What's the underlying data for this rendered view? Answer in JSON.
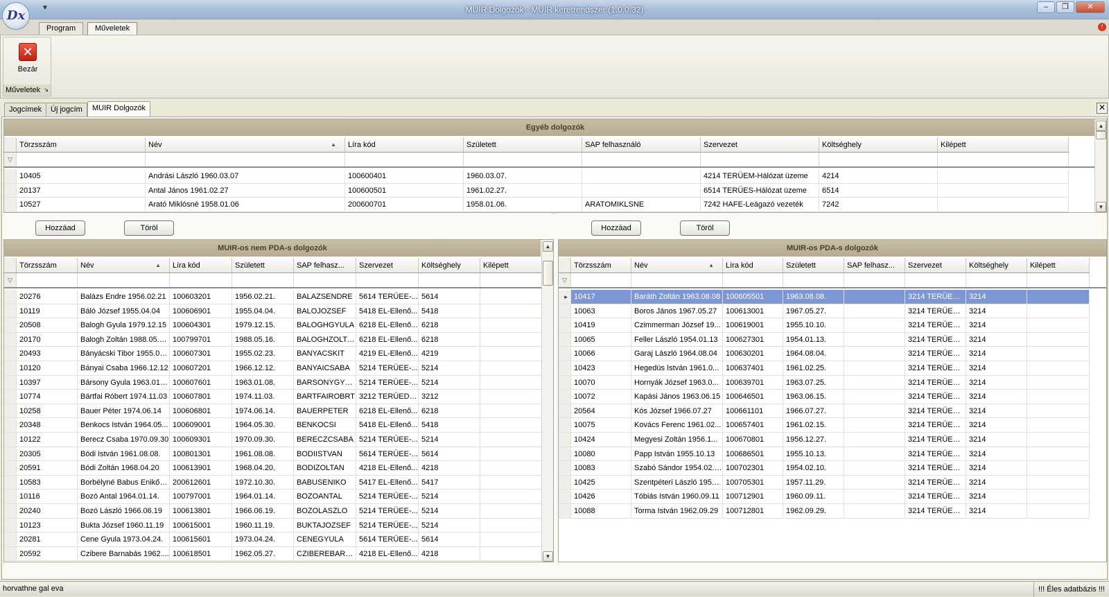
{
  "window": {
    "title": "MUIR Dolgozók - MUIR keretrendszer (1.0.0.32)",
    "logo_text": "Dx"
  },
  "ribbon": {
    "tabs": [
      "Program",
      "Műveletek"
    ],
    "active_tab": "Műveletek",
    "group_label": "Műveletek",
    "close_button": "Bezár"
  },
  "doc_tabs": [
    "Jogcímek",
    "Új jogcím",
    "MUIR Dolgozók"
  ],
  "active_doc_tab": "MUIR Dolgozók",
  "top_panel": {
    "title": "Egyéb dolgozók",
    "columns": [
      "Törzsszám",
      "Név",
      "Líra kód",
      "Született",
      "SAP felhasználó",
      "Szervezet",
      "Költséghely",
      "Kilépett"
    ],
    "sort_column": "Név",
    "rows": [
      [
        "10405",
        "Andrási László 1960.03.07",
        "100600401",
        "1960.03.07.",
        "",
        "4214 TERÜEM-Hálózat üzeme",
        "4214",
        ""
      ],
      [
        "20137",
        "Antal János 1961.02.27",
        "100600501",
        "1961.02.27.",
        "",
        "6514 TERÜES-Hálózat üzeme",
        "6514",
        ""
      ],
      [
        "10527",
        "Arató Miklósné 1958.01.06",
        "200600701",
        "1958.01.06.",
        "ARATOMIKLSNE",
        "7242 HAFE-Leágazó vezeték",
        "7242",
        ""
      ]
    ]
  },
  "left_buttons": {
    "add": "Hozzáad",
    "remove": "Töröl"
  },
  "right_buttons": {
    "add": "Hozzáad",
    "remove": "Töröl"
  },
  "left_panel": {
    "title": "MUIR-os nem PDA-s dolgozók",
    "columns": [
      "Törzsszám",
      "Név",
      "Líra kód",
      "Született",
      "SAP felhasz...",
      "Szervezet",
      "Költséghely",
      "Kilépett"
    ],
    "sort_column": "Név",
    "rows": [
      [
        "20276",
        "Balázs Endre 1956.02.21",
        "100603201",
        "1956.02.21.",
        "BALAZSENDRE",
        "5614 TERÜEE-...",
        "5614",
        ""
      ],
      [
        "10119",
        "Báló József 1955.04.04",
        "100606901",
        "1955.04.04.",
        "BALOJOZSEF",
        "5418 EL-Ellenő...",
        "5418",
        ""
      ],
      [
        "20508",
        "Balogh Gyula 1979.12.15",
        "100604301",
        "1979.12.15.",
        "BALOGHGYULA",
        "6218 EL-Ellenő...",
        "6218",
        ""
      ],
      [
        "20170",
        "Balogh Zoltán 1988.05.16.",
        "100799701",
        "1988.05.16.",
        "BALOGHZOLTAN",
        "6218 EL-Ellenő...",
        "6218",
        ""
      ],
      [
        "20493",
        "Bányácski Tibor 1955.02...",
        "100607301",
        "1955.02.23.",
        "BANYACSKIT",
        "4219 EL-Ellenő...",
        "4219",
        ""
      ],
      [
        "10120",
        "Bányai Csaba 1966.12.12",
        "100607201",
        "1966.12.12.",
        "BANYAICSABA",
        "5214 TERÜEE-...",
        "5214",
        ""
      ],
      [
        "10397",
        "Bársony Gyula 1963.01.08",
        "100607601",
        "1963.01.08.",
        "BARSONYGYULA",
        "5214 TERÜEE-...",
        "5214",
        ""
      ],
      [
        "10774",
        "Bártfai Róbert 1974.11.03",
        "100607801",
        "1974.11.03.",
        "BARTFAIROBRT",
        "3212 TERÜED-...",
        "3212",
        ""
      ],
      [
        "10258",
        "Bauer Péter 1974.06.14",
        "100606801",
        "1974.06.14.",
        "BAUERPETER",
        "6218 EL-Ellenő...",
        "6218",
        ""
      ],
      [
        "20348",
        "Benkocs István 1964.05...",
        "100609001",
        "1964.05.30.",
        "BENKOCSI",
        "5418 EL-Ellenő...",
        "5418",
        ""
      ],
      [
        "10122",
        "Berecz Csaba 1970.09.30",
        "100609301",
        "1970.09.30.",
        "BERECZCSABA",
        "5214 TERÜEE-...",
        "5214",
        ""
      ],
      [
        "20305",
        "Bódi István 1961.08.08.",
        "100801301",
        "1961.08.08.",
        "BODIISTVAN",
        "5614 TERÜEE-...",
        "5614",
        ""
      ],
      [
        "20591",
        "Bódi Zoltán 1968.04.20",
        "100613901",
        "1968.04.20.",
        "BODIZOLTAN",
        "4218 EL-Ellenő...",
        "4218",
        ""
      ],
      [
        "10583",
        "Borbélyné Babus Enikő 1...",
        "200612601",
        "1972.10.30.",
        "BABUSENIKO",
        "5417 EL-Ellenő...",
        "5417",
        ""
      ],
      [
        "10116",
        "Bozó Antal 1964.01.14.",
        "100797001",
        "1964.01.14.",
        "BOZOANTAL",
        "5214 TERÜEE-...",
        "5214",
        ""
      ],
      [
        "20240",
        "Bozó László 1966.06.19",
        "100613801",
        "1966.06.19.",
        "BOZOLASZLO",
        "5214 TERÜEE-...",
        "5214",
        ""
      ],
      [
        "10123",
        "Bukta József 1960.11.19",
        "100615001",
        "1960.11.19.",
        "BUKTAJOZSEF",
        "5214 TERÜEE-...",
        "5214",
        ""
      ],
      [
        "20281",
        "Cene Gyula 1973.04.24.",
        "100615601",
        "1973.04.24.",
        "CENEGYULA",
        "5614 TERÜEE-...",
        "5614",
        ""
      ],
      [
        "20592",
        "Czibere Barnabás 1962....",
        "100618501",
        "1962.05.27.",
        "CZIBEREBARNA",
        "4218 EL-Ellenő...",
        "4218",
        ""
      ]
    ]
  },
  "right_panel": {
    "title": "MUIR-os PDA-s dolgozók",
    "columns": [
      "Törzsszám",
      "Név",
      "Líra kód",
      "Született",
      "SAP felhasz...",
      "Szervezet",
      "Költséghely",
      "Kilépett"
    ],
    "sort_column": "Név",
    "rows": [
      [
        "10417",
        "Baráth Zoltán 1963.08.08",
        "100605501",
        "1963.08.08.",
        "",
        "3214 TERÜED-...",
        "3214",
        ""
      ],
      [
        "10063",
        "Boros János 1967.05.27",
        "100613001",
        "1967.05.27.",
        "",
        "3214 TERÜED-...",
        "3214",
        ""
      ],
      [
        "10419",
        "Czimmerman József 19...",
        "100619001",
        "1955.10.10.",
        "",
        "3214 TERÜED-...",
        "3214",
        ""
      ],
      [
        "10065",
        "Feller László 1954.01.13",
        "100627301",
        "1954.01.13.",
        "",
        "3214 TERÜED-...",
        "3214",
        ""
      ],
      [
        "10066",
        "Garaj László 1964.08.04",
        "100630201",
        "1964.08.04.",
        "",
        "3214 TERÜED-...",
        "3214",
        ""
      ],
      [
        "10423",
        "Hegedüs István 1961.0...",
        "100637401",
        "1961.02.25.",
        "",
        "3214 TERÜED-...",
        "3214",
        ""
      ],
      [
        "10070",
        "Hornyák József 1963.0...",
        "100639701",
        "1963.07.25.",
        "",
        "3214 TERÜED-...",
        "3214",
        ""
      ],
      [
        "10072",
        "Kapási János 1963.06.15",
        "100646501",
        "1963.06.15.",
        "",
        "3214 TERÜED-...",
        "3214",
        ""
      ],
      [
        "20564",
        "Kós József 1966.07.27",
        "100661101",
        "1966.07.27.",
        "",
        "3214 TERÜED-...",
        "3214",
        ""
      ],
      [
        "10075",
        "Kovács Ferenc 1961.02...",
        "100657401",
        "1961.02.15.",
        "",
        "3214 TERÜED-...",
        "3214",
        ""
      ],
      [
        "10424",
        "Megyesi Zoltán 1956.1...",
        "100670801",
        "1956.12.27.",
        "",
        "3214 TERÜED-...",
        "3214",
        ""
      ],
      [
        "10080",
        "Papp István 1955.10.13",
        "100686501",
        "1955.10.13.",
        "",
        "3214 TERÜED-...",
        "3214",
        ""
      ],
      [
        "10083",
        "Szabó Sándor 1954.02.10",
        "100702301",
        "1954.02.10.",
        "",
        "3214 TERÜED-...",
        "3214",
        ""
      ],
      [
        "10425",
        "Szentpéteri László 1957...",
        "100705301",
        "1957.11.29.",
        "",
        "3214 TERÜED-...",
        "3214",
        ""
      ],
      [
        "10426",
        "Tóbiás István 1960.09.11",
        "100712901",
        "1960.09.11.",
        "",
        "3214 TERÜED-...",
        "3214",
        ""
      ],
      [
        "10088",
        "Torma István 1962.09.29",
        "100712801",
        "1962.09.29.",
        "",
        "3214 TERÜED-...",
        "3214",
        ""
      ]
    ],
    "selected_row": 0
  },
  "status": {
    "user": "horvathne gal eva",
    "environment": "!!! Éles adatbázis !!!"
  }
}
